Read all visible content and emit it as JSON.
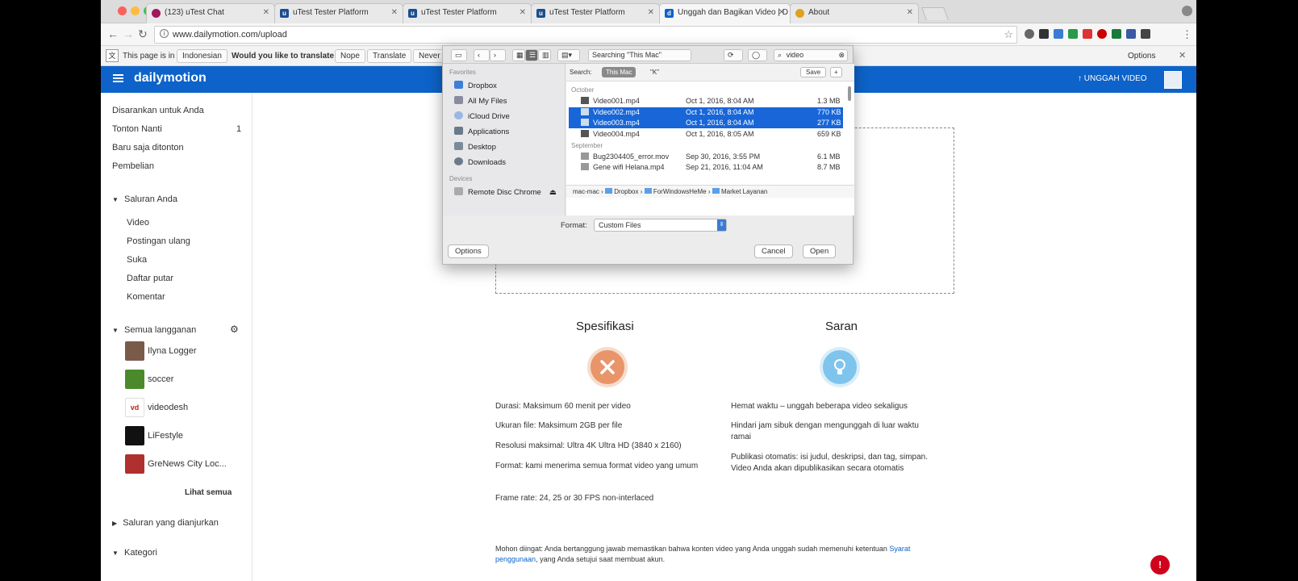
{
  "browser": {
    "tabs": [
      {
        "title": "(123) uTest Chat",
        "favicon_color": "#a0185c"
      },
      {
        "title": "uTest Tester Platform",
        "favicon_color": "#1a4e8f"
      },
      {
        "title": "uTest Tester Platform",
        "favicon_color": "#1a4e8f"
      },
      {
        "title": "uTest Tester Platform",
        "favicon_color": "#1a4e8f"
      },
      {
        "title": "Unggah dan Bagikan Video | D",
        "favicon_color": "#0d63c9"
      },
      {
        "title": "About",
        "favicon_color": "#e0a020"
      }
    ],
    "url": "www.dailymotion.com/upload",
    "translate_bar": {
      "page_is_in": "This page is in",
      "language": "Indonesian",
      "question": "Would you like to translate it?",
      "nope": "Nope",
      "translate": "Translate",
      "never": "Never",
      "options": "Options"
    }
  },
  "dailymotion": {
    "logo": "dailymotion",
    "upload_button": "UNGGAH VIDEO",
    "accent_color": "#0d63c9"
  },
  "sidebar": {
    "top_items": [
      "Disarankan untuk Anda",
      "Tonton Nanti",
      "Baru saja ditonton",
      "Pembelian"
    ],
    "watch_later_count": "1",
    "channel_section": "Saluran Anda",
    "channel_items": [
      "Video",
      "Postingan ulang",
      "Suka",
      "Daftar putar",
      "Komentar"
    ],
    "subs_section": "Semua langganan",
    "subscriptions": [
      {
        "name": "Ilyna Logger",
        "color": "#7a5a48"
      },
      {
        "name": "soccer",
        "color": "#4a8a2a"
      },
      {
        "name": "videodesh",
        "color": "#c02020"
      },
      {
        "name": "LiFestyle",
        "color": "#111111"
      },
      {
        "name": "GreNews City Loc...",
        "color": "#b03030"
      }
    ],
    "see_all": "Lihat semua",
    "recommended": "Saluran yang dianjurkan",
    "categories": "Kategori"
  },
  "main": {
    "spec_title": "Spesifikasi",
    "spec_items": [
      "Durasi: Maksimum 60 menit per video",
      "Ukuran file: Maksimum 2GB per file",
      "Resolusi maksimal: Ultra 4K Ultra HD (3840 x 2160)",
      "Format: kami menerima semua format video yang umum",
      "Frame rate: 24, 25 or 30 FPS non-interlaced"
    ],
    "tips_title": "Saran",
    "tips_items": [
      "Hemat waktu – unggah beberapa video sekaligus",
      "Hindari jam sibuk dengan mengunggah di luar waktu ramai",
      "Publikasi otomatis: isi judul, deskripsi, dan tag, simpan. Video Anda akan dipublikasikan secara otomatis"
    ],
    "footnote_prefix": "Mohon diingat: Anda bertanggung jawab memastikan bahwa konten video yang Anda unggah sudah memenuhi ketentuan",
    "footnote_link": "Syarat penggunaan",
    "footnote_suffix": ", yang Anda setujui saat membuat akun.",
    "alert_badge": "!",
    "spec_color": "#e8956a",
    "tips_color": "#7fc4ec"
  },
  "dialog": {
    "search_field": "video",
    "search_scope_label": "Searching \"This Mac\"",
    "scope_label": "Search:",
    "scope_this_mac": "This Mac",
    "scope_folder": "\"K\"",
    "save_button": "Save",
    "favorites_heading": "Favorites",
    "favorites": [
      {
        "label": "Dropbox",
        "color": "#3d7fd6"
      },
      {
        "label": "All My Files",
        "color": "#8a8aa0"
      },
      {
        "label": "iCloud Drive",
        "color": "#9ab8e0"
      },
      {
        "label": "Applications",
        "color": "#6a7a8a"
      },
      {
        "label": "Desktop",
        "color": "#7a8a9a"
      },
      {
        "label": "Downloads",
        "color": "#6a7a8a"
      }
    ],
    "devices_heading": "Devices",
    "device": "Remote Disc  Chrome",
    "group_earlier": "October",
    "files": [
      {
        "name": "Video001.mp4",
        "date": "Oct 1, 2016, 8:04 AM",
        "size": "1.3 MB",
        "selected": false
      },
      {
        "name": "Video002.mp4",
        "date": "Oct 1, 2016, 8:04 AM",
        "size": "770 KB",
        "selected": true
      },
      {
        "name": "Video003.mp4",
        "date": "Oct 1, 2016, 8:04 AM",
        "size": "277 KB",
        "selected": true
      },
      {
        "name": "Video004.mp4",
        "date": "Oct 1, 2016, 8:05 AM",
        "size": "659 KB",
        "selected": false
      }
    ],
    "group_september": "September",
    "files_sept": [
      {
        "name": "Bug2304405_error.mov",
        "date": "Sep 30, 2016, 3:55 PM",
        "size": "6.1 MB"
      },
      {
        "name": "Gene wifi Helana.mp4",
        "date": "Sep 21, 2016, 11:04 AM",
        "size": "8.7 MB"
      }
    ],
    "path": [
      "mac-mac",
      "Dropbox",
      "ForWindowsHeMe",
      "Market Layanan"
    ],
    "format_label": "Format:",
    "format_value": "Custom Files",
    "options_button": "Options",
    "cancel_button": "Cancel",
    "open_button": "Open"
  }
}
